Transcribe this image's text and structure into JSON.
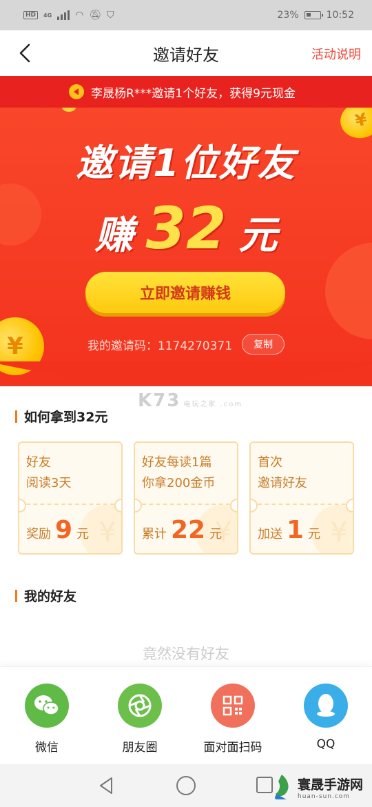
{
  "status_bar": {
    "hd_badge": "HD",
    "network": "4G",
    "battery_percent": "23%",
    "time": "10:52"
  },
  "header": {
    "title": "邀请好友",
    "rules_link": "活动说明"
  },
  "ticker": {
    "message": "李晟杨R***邀请1个好友，获得9元现金"
  },
  "hero": {
    "headline": "邀请1位好友",
    "earn_prefix": "赚",
    "earn_amount": "32",
    "earn_unit": "元",
    "invite_button": "立即邀请赚钱",
    "invite_code_label": "我的邀请码：",
    "invite_code": "1174270371",
    "copy_button": "复制",
    "coin_symbol": "¥"
  },
  "watermark": {
    "text": "K73",
    "sub": "电玩之家 .com"
  },
  "how_section": {
    "title": "如何拿到32元",
    "cards": [
      {
        "line1": "好友",
        "line2": "阅读3天",
        "reward_prefix": "奖励",
        "reward_value": "9",
        "reward_unit": "元"
      },
      {
        "line1": "好友每读1篇",
        "line2": "你拿200金币",
        "reward_prefix": "累计",
        "reward_value": "22",
        "reward_unit": "元"
      },
      {
        "line1": "首次",
        "line2": "邀请好友",
        "reward_prefix": "加送",
        "reward_value": "1",
        "reward_unit": "元"
      }
    ]
  },
  "friends_section": {
    "title": "我的好友",
    "empty_text": "竟然没有好友"
  },
  "share": {
    "items": [
      {
        "label": "微信",
        "icon": "wechat-icon",
        "color": "#5fba46"
      },
      {
        "label": "朋友圈",
        "icon": "moments-icon",
        "color": "#6cbf4a"
      },
      {
        "label": "面对面扫码",
        "icon": "qrcode-icon",
        "color": "#f0705c"
      },
      {
        "label": "QQ",
        "icon": "qq-icon",
        "color": "#3aaee8"
      }
    ]
  },
  "brand": {
    "name": "寰晟手游网",
    "url": "huan-sun.com"
  },
  "colors": {
    "accent_red": "#f04a3a",
    "hero_red": "#f3321e",
    "gold": "#ffc90e",
    "card_border": "#f9dca5",
    "card_text": "#c77c28"
  }
}
